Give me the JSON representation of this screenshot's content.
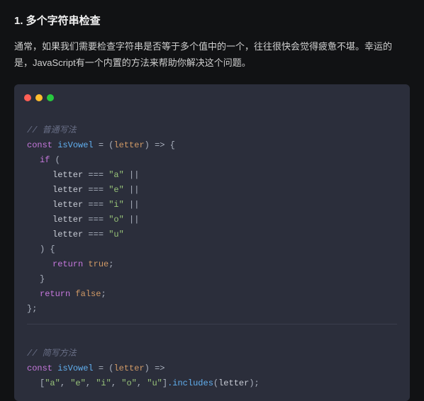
{
  "heading": "1. 多个字符串检查",
  "paragraph": "通常，如果我们需要检查字符串是否等于多个值中的一个，往往很快会觉得疲惫不堪。幸运的是，JavaScript有一个内置的方法来帮助你解决这个问题。",
  "code": {
    "block1": {
      "comment": "// 普通写法",
      "l1_const": "const",
      "l1_fn": "isVowel",
      "l1_eq": " = (",
      "l1_param": "letter",
      "l1_arrow": ") => {",
      "l2_if": "if",
      "l2_open": " (",
      "cmp_letter": "letter",
      "cmp_eqeq": " === ",
      "cmp_or": " ||",
      "v_a": "\"a\"",
      "v_e": "\"e\"",
      "v_i": "\"i\"",
      "v_o": "\"o\"",
      "v_u": "\"u\"",
      "l_close_paren": ") {",
      "ret": "return",
      "true": "true",
      "false": "false",
      "semi": ";",
      "brace_close": "}",
      "fn_close": "};"
    },
    "block2": {
      "comment": "// 简写方法",
      "const": "const",
      "fn": "isVowel",
      "eq": " = (",
      "param": "letter",
      "arrow": ") =>",
      "arr_open": "[",
      "v_a": "\"a\"",
      "v_e": "\"e\"",
      "v_i": "\"i\"",
      "v_o": "\"o\"",
      "v_u": "\"u\"",
      "comma": ", ",
      "arr_close": "]",
      "method": ".includes",
      "call_open": "(",
      "call_arg": "letter",
      "call_close": ");"
    }
  }
}
